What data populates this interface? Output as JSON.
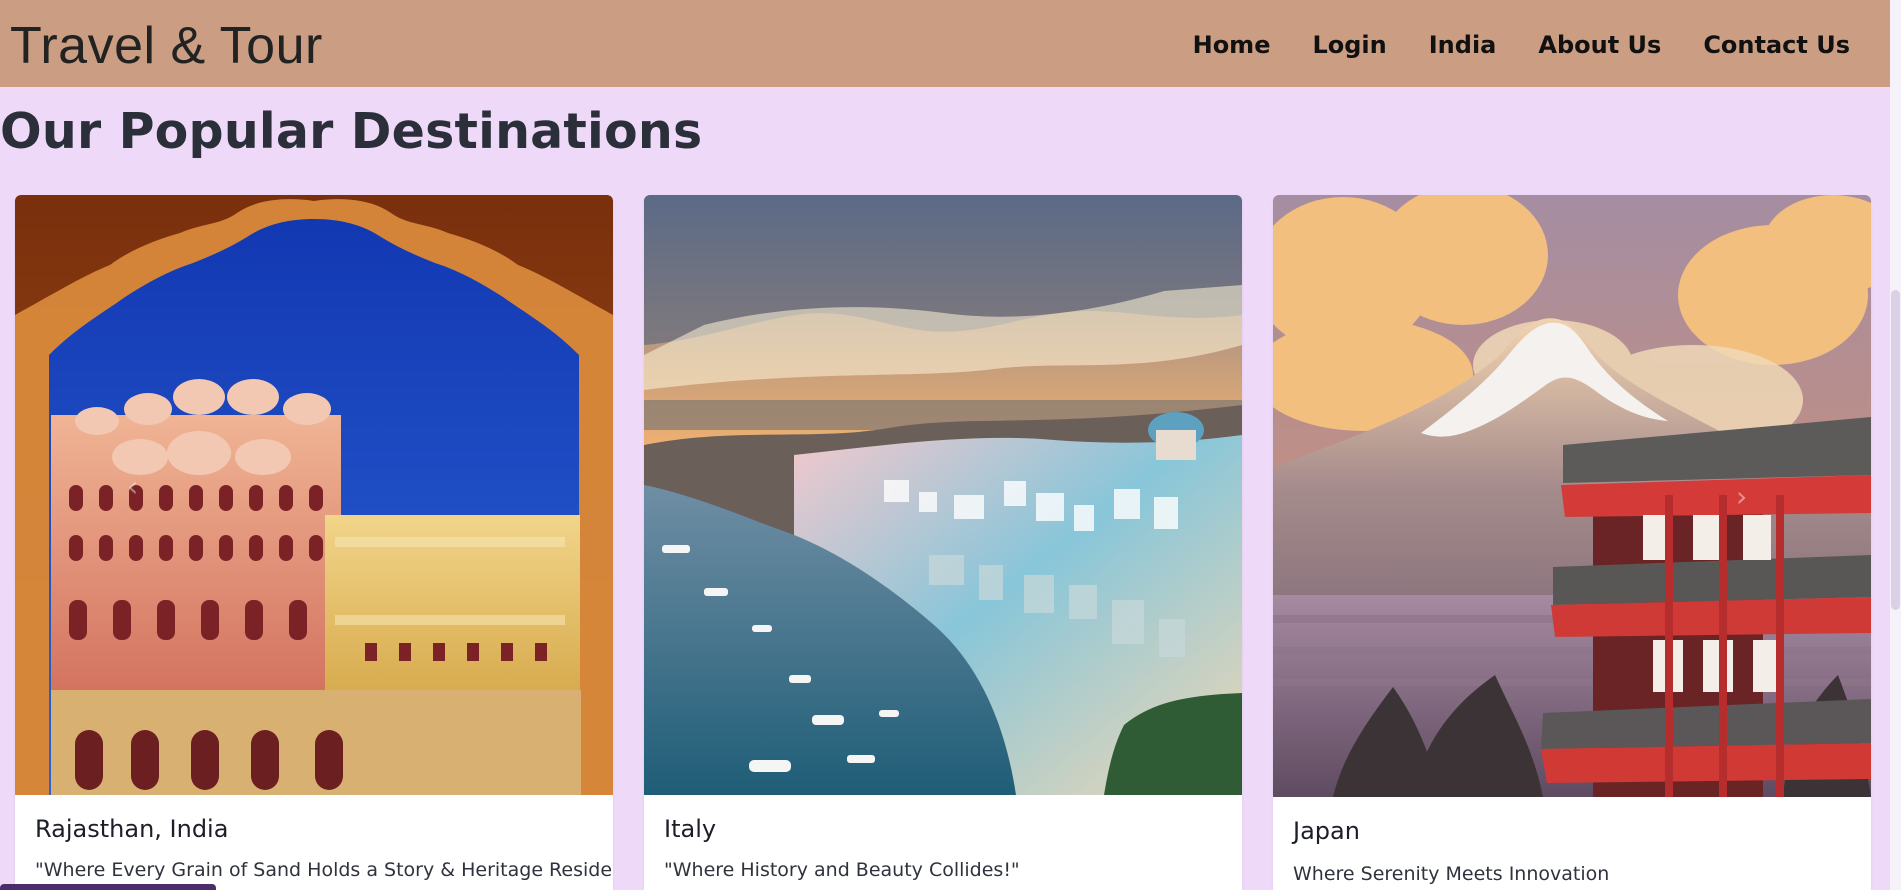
{
  "header": {
    "brand": "Travel & Tour",
    "nav": [
      {
        "label": "Home"
      },
      {
        "label": "Login"
      },
      {
        "label": "India"
      },
      {
        "label": "About Us"
      },
      {
        "label": "Contact Us"
      }
    ]
  },
  "main": {
    "section_title": "Our Popular Destinations",
    "cards": [
      {
        "title": "Rajasthan, India",
        "text": "\"Where Every Grain of Sand Holds a Story & Heritage Resides"
      },
      {
        "title": "Italy",
        "text": "\"Where History and Beauty Collides!\""
      },
      {
        "title": "Japan",
        "text": "Where Serenity Meets Innovation"
      }
    ]
  },
  "colors": {
    "page_background": "#EED9F8",
    "header_background": "#CB9D82",
    "card_background": "#FFFFFF",
    "bottom_bar": "#4B2E69"
  },
  "icons": {
    "carousel_prev": "chevron-left-icon",
    "carousel_next": "chevron-right-icon"
  }
}
